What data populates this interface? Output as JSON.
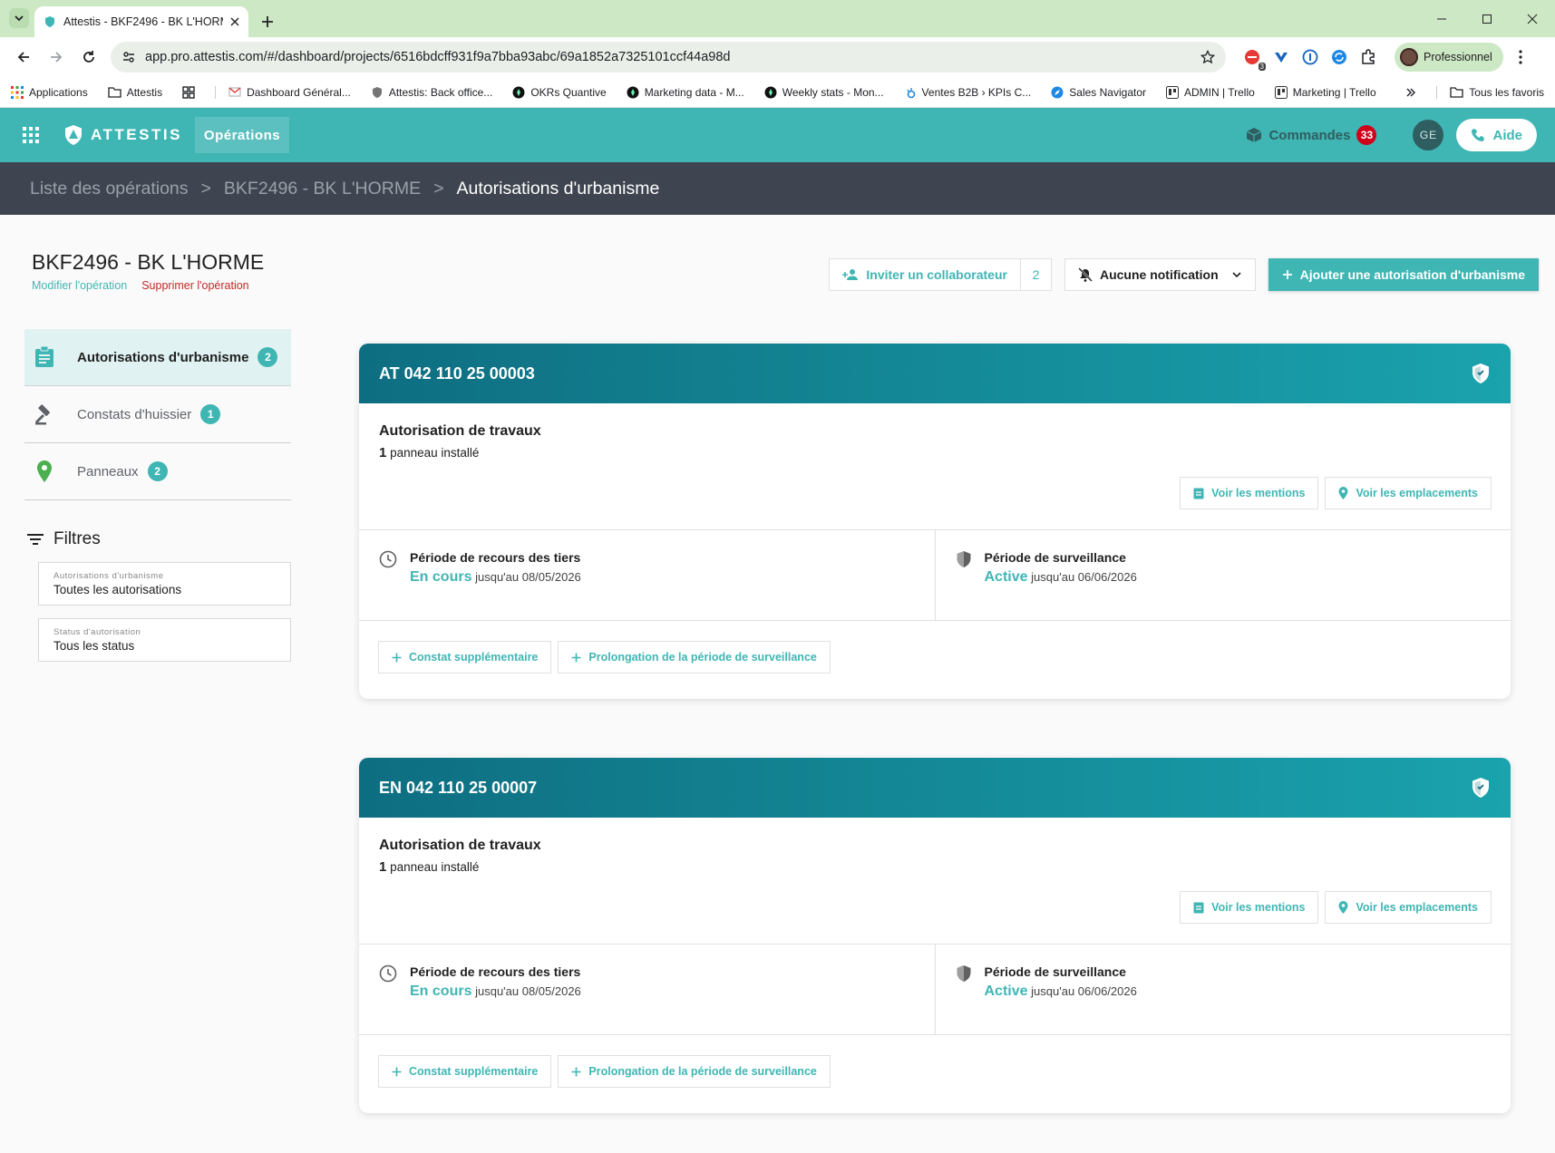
{
  "browser": {
    "tab_title": "Attestis - BKF2496 - BK L'HORM",
    "url": "app.pro.attestis.com/#/dashboard/projects/6516bdcff931f9a7bba93abc/69a1852a7325101ccf44a98d",
    "extension_badge": "3",
    "profile_label": "Professionnel",
    "bookmarks": [
      {
        "label": "Applications",
        "icon": "apps-grid-icon"
      },
      {
        "label": "Attestis",
        "icon": "folder-icon"
      },
      {
        "label": "",
        "icon": "grid-icon"
      },
      {
        "label": "Dashboard Général...",
        "icon": "gmail-icon"
      },
      {
        "label": "Attestis: Back office...",
        "icon": "attestis-icon"
      },
      {
        "label": "OKRs Quantive",
        "icon": "quantive-icon"
      },
      {
        "label": "Marketing data - M...",
        "icon": "marketing-icon"
      },
      {
        "label": "Weekly stats - Mon...",
        "icon": "monday-icon"
      },
      {
        "label": "Ventes B2B › KPIs C...",
        "icon": "hubspot-icon"
      },
      {
        "label": "Sales Navigator",
        "icon": "compass-icon"
      },
      {
        "label": "ADMIN | Trello",
        "icon": "trello-icon"
      },
      {
        "label": "Marketing | Trello",
        "icon": "trello-icon"
      }
    ],
    "all_favorites": "Tous les favoris"
  },
  "appbar": {
    "logo_text": "ATTESTIS",
    "section": "Opérations",
    "orders_label": "Commandes",
    "orders_count": "33",
    "user_initials": "GE",
    "help_label": "Aide"
  },
  "breadcrumb": {
    "items": [
      "Liste des opérations",
      "BKF2496 - BK L'HORME",
      "Autorisations d'urbanisme"
    ],
    "separator": ">"
  },
  "page": {
    "title": "BKF2496 - BK L'HORME",
    "modify_label": "Modifier l'opération",
    "delete_label": "Supprimer l'opération",
    "invite_label": "Inviter un collaborateur",
    "invite_count": "2",
    "notification_label": "Aucune notification",
    "add_label": "Ajouter une autorisation d'urbanisme"
  },
  "sidebar": {
    "items": [
      {
        "label": "Autorisations d'urbanisme",
        "count": "2",
        "active": true,
        "icon": "clipboard-icon"
      },
      {
        "label": "Constats d'huissier",
        "count": "1",
        "active": false,
        "icon": "gavel-icon"
      },
      {
        "label": "Panneaux",
        "count": "2",
        "active": false,
        "icon": "map-pin-icon"
      }
    ],
    "filters_title": "Filtres",
    "filters": [
      {
        "label": "Autorisations d'urbanisme",
        "value": "Toutes les autorisations"
      },
      {
        "label": "Status d'autorisation",
        "value": "Tous les status"
      }
    ]
  },
  "cards": [
    {
      "id": "AT 042 110 25 00003",
      "type": "Autorisation de travaux",
      "panel_count": "1",
      "panel_label": "panneau installé",
      "mentions_label": "Voir les mentions",
      "locations_label": "Voir les emplacements",
      "recours_title": "Période de recours des tiers",
      "recours_status": "En cours",
      "recours_until": "jusqu'au 08/05/2026",
      "surveillance_title": "Période de surveillance",
      "surveillance_status": "Active",
      "surveillance_until": "jusqu'au 06/06/2026",
      "extra_label": "Constat supplémentaire",
      "extend_label": "Prolongation de la période de surveillance"
    },
    {
      "id": "EN 042 110 25 00007",
      "type": "Autorisation de travaux",
      "panel_count": "1",
      "panel_label": "panneau installé",
      "mentions_label": "Voir les mentions",
      "locations_label": "Voir les emplacements",
      "recours_title": "Période de recours des tiers",
      "recours_status": "En cours",
      "recours_until": "jusqu'au 08/05/2026",
      "surveillance_title": "Période de surveillance",
      "surveillance_status": "Active",
      "surveillance_until": "jusqu'au 06/06/2026",
      "extra_label": "Constat supplémentaire",
      "extend_label": "Prolongation de la période de surveillance"
    }
  ],
  "colors": {
    "primary": "#3fb6b4",
    "header_dark": "#0e6e81",
    "breadcrumb_bg": "#3f4550",
    "danger": "#c62828",
    "badge_red": "#d0021b"
  }
}
